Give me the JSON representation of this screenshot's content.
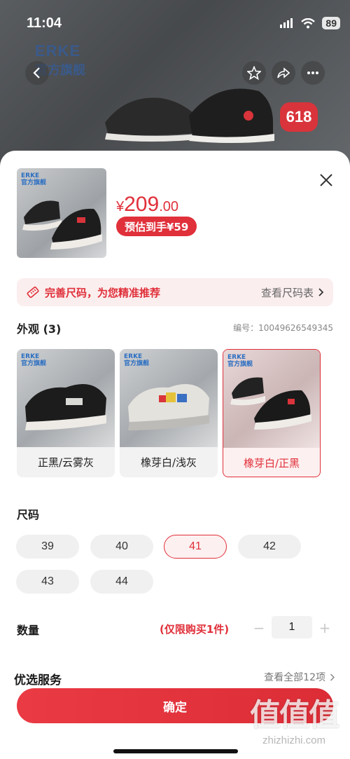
{
  "status_bar": {
    "time": "11:04",
    "battery": "89"
  },
  "background": {
    "brand_en": "ERKE",
    "brand_cn": "官方旗舰",
    "promo_badge": "618"
  },
  "product": {
    "price_currency": "¥",
    "price_integer": "209",
    "price_decimal": ".00",
    "estimated_price": "预估到手¥59",
    "thumb_brand_en": "ERKE",
    "thumb_brand_cn": "官方旗舰"
  },
  "size_tip": {
    "text": "完善尺码，为您精准推荐",
    "link": "查看尺码表"
  },
  "appearance": {
    "title": "外观 (3)",
    "sku": "编号：10049626549345",
    "options": [
      {
        "label": "正黑/云雾灰",
        "selected": false,
        "brand_en": "ERKE",
        "brand_cn": "官方旗舰"
      },
      {
        "label": "橡芽白/浅灰",
        "selected": false,
        "brand_en": "ERKE",
        "brand_cn": "官方旗舰"
      },
      {
        "label": "橡芽白/正黑",
        "selected": true,
        "brand_en": "ERKE",
        "brand_cn": "官方旗舰"
      }
    ]
  },
  "size": {
    "title": "尺码",
    "options": [
      {
        "label": "39",
        "selected": false
      },
      {
        "label": "40",
        "selected": false
      },
      {
        "label": "41",
        "selected": true
      },
      {
        "label": "42",
        "selected": false
      },
      {
        "label": "43",
        "selected": false
      },
      {
        "label": "44",
        "selected": false
      }
    ]
  },
  "quantity": {
    "title": "数量",
    "limit": "(仅限购买1件)",
    "minus": "−",
    "value": "1",
    "plus": "+"
  },
  "service": {
    "title": "优选服务",
    "link": "查看全部12项"
  },
  "confirm_label": "确定",
  "watermark": {
    "big": "值值值",
    "small": "zhizhizhi.com"
  },
  "colors": {
    "accent": "#e0303a",
    "brand_blue": "#2c6fc2"
  }
}
